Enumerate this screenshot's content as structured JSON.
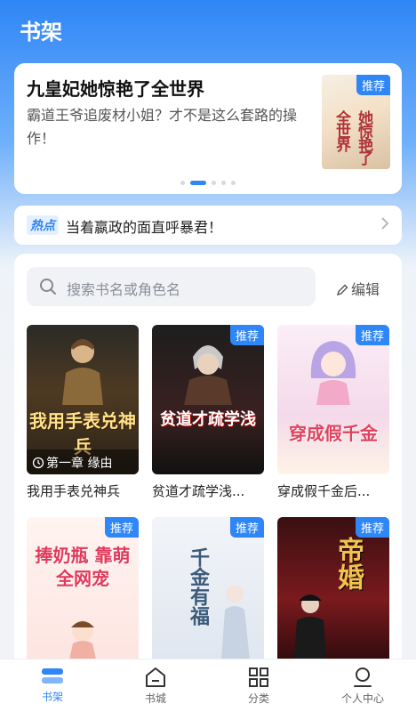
{
  "header": {
    "title": "书架"
  },
  "banner": {
    "title": "九皇妃她惊艳了全世界",
    "description": "霸道王爷追废材小姐？才不是这么套路的操作！",
    "tag": "推荐",
    "cover_text": "她惊艳了全世界",
    "page_count": 5,
    "active_page": 2
  },
  "notice": {
    "badge": "热点",
    "text": "当着嬴政的面直呼暴君！"
  },
  "search": {
    "placeholder": "搜索书名或角色名"
  },
  "edit_label": "编辑",
  "books": [
    {
      "name": "我用手表兑神兵",
      "cover_title": "我用手表兑神兵",
      "progress": "第一章 缘由",
      "tag": ""
    },
    {
      "name": "贫道才疏学浅...",
      "cover_title": "贫道才疏学浅",
      "tag": "推荐"
    },
    {
      "name": "穿成假千金后...",
      "cover_title": "穿成假千金",
      "tag": "推荐"
    },
    {
      "name": "",
      "cover_title": "捧奶瓶 靠萌全网宠",
      "tag": "推荐"
    },
    {
      "name": "",
      "cover_title": "千金有福",
      "tag": "推荐"
    },
    {
      "name": "",
      "cover_title": "帝婚",
      "tag": "推荐"
    }
  ],
  "tabbar": [
    {
      "label": "书架",
      "icon": "bookshelf-icon",
      "active": true
    },
    {
      "label": "书城",
      "icon": "home-icon",
      "active": false
    },
    {
      "label": "分类",
      "icon": "grid-icon",
      "active": false
    },
    {
      "label": "个人中心",
      "icon": "user-icon",
      "active": false
    }
  ],
  "colors": {
    "accent": "#2f86f6"
  }
}
